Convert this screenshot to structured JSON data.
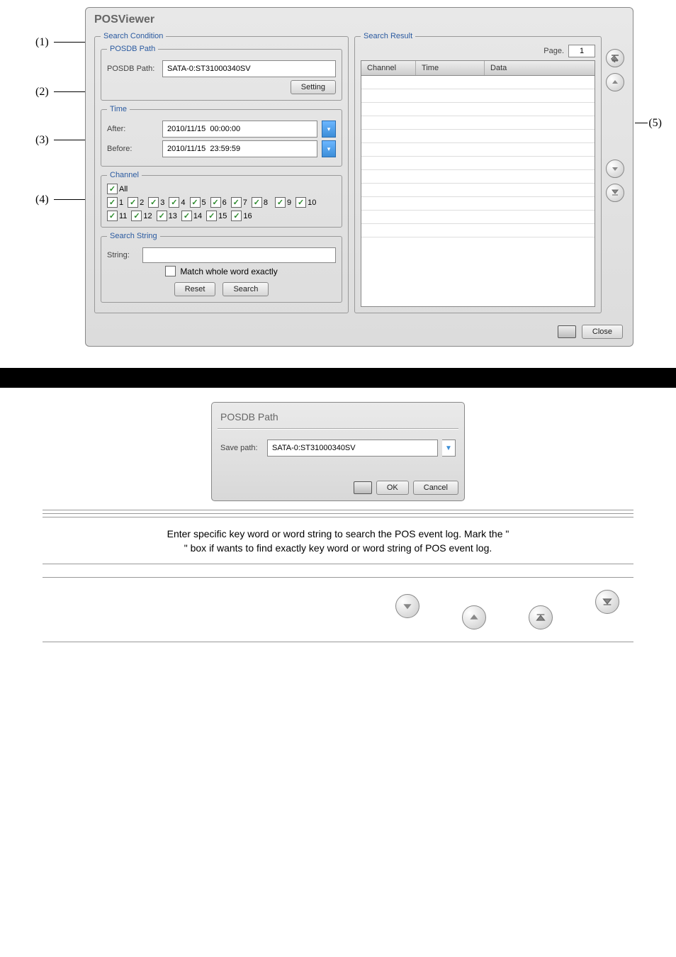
{
  "window": {
    "title": "POSViewer",
    "close_label": "Close"
  },
  "searchCondition": {
    "legend": "Search Condition"
  },
  "posdbPath": {
    "legend": "POSDB Path",
    "label": "POSDB Path:",
    "value": "SATA-0:ST31000340SV",
    "setting_label": "Setting"
  },
  "time": {
    "legend": "Time",
    "after_label": "After:",
    "after_value": "2010/11/15  00:00:00",
    "before_label": "Before:",
    "before_value": "2010/11/15  23:59:59"
  },
  "channel": {
    "legend": "Channel",
    "all_label": "All",
    "items": [
      "1",
      "2",
      "3",
      "4",
      "5",
      "6",
      "7",
      "8",
      "9",
      "10",
      "11",
      "12",
      "13",
      "14",
      "15",
      "16"
    ]
  },
  "searchString": {
    "legend": "Search String",
    "label": "String:",
    "match_label": "Match whole word exactly",
    "reset_label": "Reset",
    "search_label": "Search"
  },
  "searchResult": {
    "legend": "Search Result",
    "page_label": "Page.",
    "page_value": "1",
    "col_channel": "Channel",
    "col_time": "Time",
    "col_data": "Data"
  },
  "posdbDialog": {
    "title": "POSDB Path",
    "save_label": "Save path:",
    "save_value": "SATA-0:ST31000340SV",
    "ok_label": "OK",
    "cancel_label": "Cancel"
  },
  "description": {
    "line1": "Enter specific key word or word string to search the POS event log. Mark the \"",
    "line2": "\" box if wants to find exactly key word or word string of POS event log."
  },
  "annotations": {
    "a1": "(1)",
    "a2": "(2)",
    "a3": "(3)",
    "a4": "(4)",
    "a5": "(5)"
  }
}
